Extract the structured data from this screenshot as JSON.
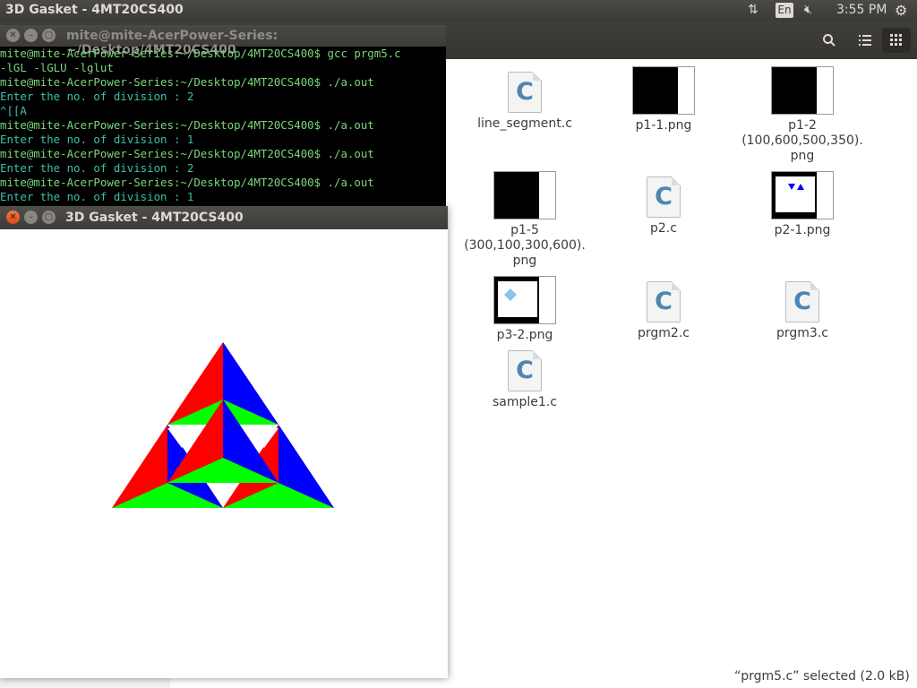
{
  "top_panel": {
    "title": "3D Gasket - 4MT20CS400",
    "lang": "En",
    "time": "3:55 PM"
  },
  "icons": {
    "network": "network-arrows-icon",
    "volume": "volume-muted-icon",
    "settings": "gear-icon",
    "search": "search-icon",
    "list_view": "list-view-icon",
    "grid_view": "grid-view-icon"
  },
  "terminal": {
    "title": "mite@mite-AcerPower-Series: ~/Desktop/4MT20CS400",
    "lines": [
      {
        "type": "prompt",
        "text": "mite@mite-AcerPower-Series:~/Desktop/4MT20CS400$ gcc prgm5.c"
      },
      {
        "type": "prompt",
        "text": "-lGL -lGLU -lglut"
      },
      {
        "type": "prompt",
        "text": "mite@mite-AcerPower-Series:~/Desktop/4MT20CS400$ ./a.out"
      },
      {
        "type": "out",
        "text": "Enter the no. of division : 2"
      },
      {
        "type": "out",
        "text": "^[[A"
      },
      {
        "type": "prompt",
        "text": "mite@mite-AcerPower-Series:~/Desktop/4MT20CS400$ ./a.out"
      },
      {
        "type": "out",
        "text": "Enter the no. of division : 1"
      },
      {
        "type": "prompt",
        "text": "mite@mite-AcerPower-Series:~/Desktop/4MT20CS400$ ./a.out"
      },
      {
        "type": "out",
        "text": "Enter the no. of division : 2"
      },
      {
        "type": "prompt",
        "text": "mite@mite-AcerPower-Series:~/Desktop/4MT20CS400$ ./a.out"
      },
      {
        "type": "out",
        "text": "Enter the no. of division : 1"
      }
    ]
  },
  "gasket_window": {
    "title": "3D Gasket - 4MT20CS400",
    "colors": {
      "red": "#ff0000",
      "green": "#00ff00",
      "blue": "#0000ff"
    }
  },
  "files": [
    {
      "name": "line_segment.c",
      "kind": "c-source"
    },
    {
      "name": "p1-1.png",
      "kind": "image"
    },
    {
      "name": "p1-2\n(100,600,500,350).\npng",
      "kind": "image"
    },
    {
      "name": "p1-5\n(300,100,300,600).\npng",
      "kind": "image"
    },
    {
      "name": "p2.c",
      "kind": "c-source"
    },
    {
      "name": "p2-1.png",
      "kind": "image"
    },
    {
      "name": "p3-2.png",
      "kind": "image"
    },
    {
      "name": "prgm2.c",
      "kind": "c-source"
    },
    {
      "name": "prgm3.c",
      "kind": "c-source"
    },
    {
      "name": "sample1.c",
      "kind": "c-source"
    }
  ],
  "status": "“prgm5.c” selected  (2.0 kB)"
}
